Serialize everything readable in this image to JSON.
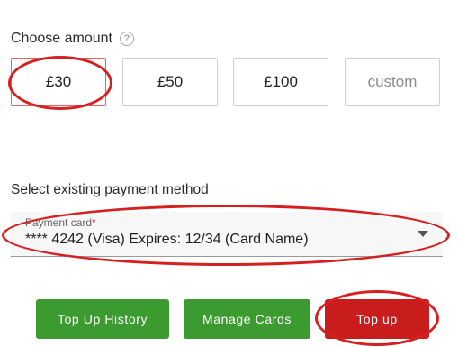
{
  "amount_section": {
    "label": "Choose amount",
    "help_glyph": "?",
    "options": [
      "£30",
      "£50",
      "£100",
      "custom"
    ],
    "selected": "£30"
  },
  "payment_section": {
    "label": "Select existing payment method",
    "field_label": "Payment card",
    "required_mark": "*",
    "selected_card": "**** 4242 (Visa) Expires: 12/34 (Card Name)"
  },
  "actions": {
    "history": "Top Up History",
    "manage": "Manage Cards",
    "top_up": "Top up"
  },
  "colors": {
    "green": "#3c9b30",
    "red": "#c91d1d",
    "annotation": "#d61f1f"
  },
  "icons": [
    "question-circle-icon",
    "chevron-down-icon"
  ]
}
